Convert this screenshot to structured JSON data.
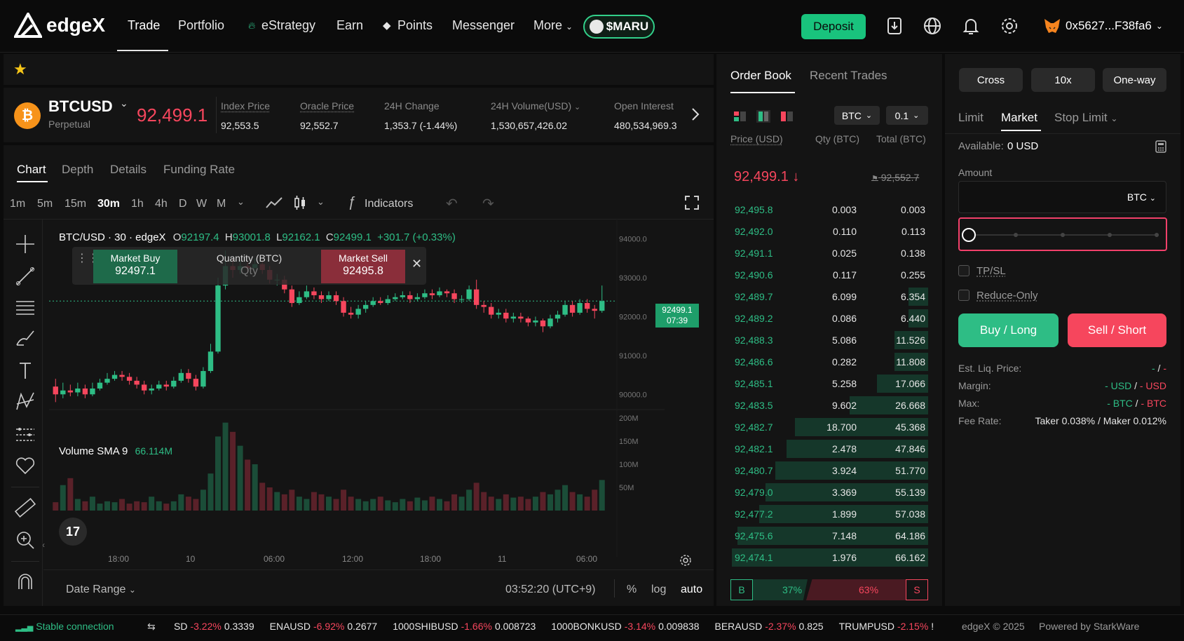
{
  "nav": {
    "logo": "edgeX",
    "items": [
      "Trade",
      "Portfolio",
      "eStrategy",
      "Earn",
      "Points",
      "Messenger",
      "More"
    ],
    "maru": "$MARU",
    "deposit": "Deposit",
    "wallet": "0x5627...F38fa6"
  },
  "ticker": {
    "symbol": "BTCUSD",
    "type": "Perpetual",
    "price": "92,499.1",
    "index_label": "Index Price",
    "index_val": "92,553.5",
    "oracle_label": "Oracle Price",
    "oracle_val": "92,552.7",
    "change_label": "24H Change",
    "change_val": "1,353.7 (-1.44%)",
    "volume_label": "24H Volume(USD)",
    "volume_val": "1,530,657,426.02",
    "oi_label": "Open Interest",
    "oi_val": "480,534,969.3"
  },
  "chart_tabs": [
    "Chart",
    "Depth",
    "Details",
    "Funding Rate"
  ],
  "timeframes": [
    "1m",
    "5m",
    "15m",
    "30m",
    "1h",
    "4h",
    "D",
    "W",
    "M"
  ],
  "indicators_label": "Indicators",
  "chart": {
    "pair": "BTC/USD · 30 · edgeX",
    "o_label": "O",
    "o": "92197.4",
    "h_label": "H",
    "h": "93001.8",
    "l_label": "L",
    "l": "92162.1",
    "c_label": "C",
    "c": "92499.1",
    "chg": "+301.7 (+0.33%)",
    "market_buy_label": "Market Buy",
    "market_buy": "92497.1",
    "qty_label": "Quantity (BTC)",
    "qty_placeholder": "Qty",
    "market_sell_label": "Market Sell",
    "market_sell": "92495.8",
    "last_tag_price": "92499.1",
    "last_tag_time": "07:39",
    "volume_label": "Volume SMA 9",
    "volume_val": "66.114M",
    "price_ticks": [
      "94000.0",
      "93000.0",
      "92000.0",
      "91000.0",
      "90000.0"
    ],
    "vol_ticks": [
      "200M",
      "150M",
      "100M",
      "50M"
    ],
    "time_ticks": [
      "18:00",
      "10",
      "06:00",
      "12:00",
      "18:00",
      "11",
      "06:00"
    ],
    "date_range": "Date Range",
    "clock": "03:52:20 (UTC+9)",
    "pct": "%",
    "log": "log",
    "auto": "auto"
  },
  "chart_data": {
    "type": "candlestick",
    "y_range": [
      89500,
      94300
    ],
    "candles": [
      [
        90200,
        90000,
        90400,
        89800
      ],
      [
        90000,
        90100,
        90300,
        89900
      ],
      [
        90100,
        90050,
        90250,
        89950
      ],
      [
        90050,
        90150,
        90300,
        89950
      ],
      [
        90150,
        90000,
        90250,
        89900
      ],
      [
        90000,
        90150,
        90300,
        89950
      ],
      [
        90150,
        90300,
        90400,
        90100
      ],
      [
        90300,
        90400,
        90550,
        90250
      ],
      [
        90400,
        90500,
        90600,
        90350
      ],
      [
        90500,
        90450,
        90600,
        90350
      ],
      [
        90450,
        90350,
        90550,
        90250
      ],
      [
        90350,
        90250,
        90450,
        90150
      ],
      [
        90250,
        90100,
        90350,
        90000
      ],
      [
        90100,
        90150,
        90250,
        90000
      ],
      [
        90150,
        90250,
        90350,
        90100
      ],
      [
        90250,
        90200,
        90350,
        90100
      ],
      [
        90200,
        90350,
        90450,
        90150
      ],
      [
        90350,
        90550,
        90650,
        90300
      ],
      [
        90550,
        90400,
        90650,
        90300
      ],
      [
        90400,
        90200,
        90500,
        90100
      ],
      [
        90200,
        90600,
        90700,
        90150
      ],
      [
        90600,
        91100,
        91300,
        90550
      ],
      [
        91100,
        92800,
        93000,
        91050
      ],
      [
        92800,
        93300,
        93700,
        92700
      ],
      [
        93300,
        93200,
        93500,
        93000
      ],
      [
        93200,
        93300,
        93450,
        93100
      ],
      [
        93300,
        93250,
        93400,
        93150
      ],
      [
        93250,
        93350,
        93500,
        93200
      ],
      [
        93350,
        93200,
        93450,
        93100
      ],
      [
        93200,
        92950,
        93300,
        92850
      ],
      [
        92950,
        92950,
        93100,
        92800
      ],
      [
        92950,
        92700,
        93050,
        92600
      ],
      [
        92700,
        92350,
        92800,
        92250
      ],
      [
        92350,
        92500,
        92650,
        92300
      ],
      [
        92500,
        92650,
        92800,
        92450
      ],
      [
        92650,
        92550,
        92750,
        92450
      ],
      [
        92550,
        92450,
        92650,
        92350
      ],
      [
        92450,
        92550,
        92650,
        92400
      ],
      [
        92550,
        92400,
        92650,
        92300
      ],
      [
        92400,
        92100,
        92500,
        92000
      ],
      [
        92100,
        92050,
        92250,
        91950
      ],
      [
        92050,
        92200,
        92300,
        91950
      ],
      [
        92200,
        92300,
        92400,
        92100
      ],
      [
        92300,
        92400,
        92500,
        92250
      ],
      [
        92400,
        92350,
        92500,
        92300
      ],
      [
        92350,
        92450,
        92550,
        92300
      ],
      [
        92450,
        92500,
        92600,
        92400
      ],
      [
        92500,
        92550,
        92650,
        92450
      ],
      [
        92550,
        92450,
        92650,
        92350
      ],
      [
        92450,
        92500,
        92600,
        92400
      ],
      [
        92500,
        92600,
        92700,
        92450
      ],
      [
        92600,
        92550,
        92700,
        92450
      ],
      [
        92550,
        92650,
        92750,
        92500
      ],
      [
        92650,
        92600,
        92700,
        92500
      ],
      [
        92600,
        92450,
        92700,
        92350
      ],
      [
        92450,
        92450,
        92550,
        92350
      ],
      [
        92450,
        92700,
        92800,
        92400
      ],
      [
        92700,
        92300,
        92950,
        92200
      ],
      [
        92300,
        92250,
        92400,
        92100
      ],
      [
        92250,
        92050,
        92350,
        91950
      ],
      [
        92050,
        92100,
        92200,
        91950
      ],
      [
        92100,
        91950,
        92200,
        91850
      ],
      [
        91950,
        92000,
        92100,
        91850
      ],
      [
        92000,
        91950,
        92100,
        91850
      ],
      [
        91950,
        91850,
        92000,
        91750
      ],
      [
        91850,
        91900,
        92000,
        91750
      ],
      [
        91900,
        91750,
        91950,
        91600
      ],
      [
        91750,
        91950,
        92050,
        91700
      ],
      [
        91950,
        92050,
        92150,
        91850
      ],
      [
        92050,
        92300,
        92400,
        92000
      ],
      [
        92300,
        92100,
        92400,
        92000
      ],
      [
        92100,
        92350,
        92450,
        92050
      ],
      [
        92350,
        92200,
        92450,
        92100
      ],
      [
        92200,
        92150,
        92300,
        91950
      ],
      [
        92150,
        92400,
        92800,
        92100
      ]
    ],
    "volumes": [
      18,
      55,
      70,
      25,
      20,
      30,
      15,
      20,
      18,
      25,
      15,
      20,
      18,
      30,
      20,
      15,
      20,
      35,
      30,
      25,
      45,
      80,
      160,
      190,
      170,
      140,
      110,
      100,
      60,
      50,
      40,
      35,
      45,
      30,
      25,
      40,
      35,
      30,
      25,
      45,
      30,
      25,
      20,
      25,
      30,
      22,
      18,
      25,
      20,
      28,
      22,
      30,
      25,
      20,
      35,
      30,
      45,
      60,
      40,
      30,
      25,
      35,
      28,
      30,
      25,
      30,
      40,
      35,
      45,
      55,
      40,
      35,
      30,
      45,
      66
    ]
  },
  "orderbook": {
    "tabs": [
      "Order Book",
      "Recent Trades"
    ],
    "asset": "BTC",
    "step": "0.1",
    "headers": [
      "Price (USD)",
      "Qty (BTC)",
      "Total (BTC)"
    ],
    "last_price": "92,499.1",
    "mark_price": "92,552.7",
    "rows": [
      {
        "p": "92,495.8",
        "q": "0.003",
        "t": "0.003",
        "d": 0.0
      },
      {
        "p": "92,492.0",
        "q": "0.110",
        "t": "0.113",
        "d": 0.0
      },
      {
        "p": "92,491.1",
        "q": "0.025",
        "t": "0.138",
        "d": 0.0
      },
      {
        "p": "92,490.6",
        "q": "0.117",
        "t": "0.255",
        "d": 0.0
      },
      {
        "p": "92,489.7",
        "q": "6.099",
        "t": "6.354",
        "d": 0.1
      },
      {
        "p": "92,489.2",
        "q": "0.086",
        "t": "6.440",
        "d": 0.1
      },
      {
        "p": "92,488.3",
        "q": "5.086",
        "t": "11.526",
        "d": 0.17
      },
      {
        "p": "92,486.6",
        "q": "0.282",
        "t": "11.808",
        "d": 0.17
      },
      {
        "p": "92,485.1",
        "q": "5.258",
        "t": "17.066",
        "d": 0.26
      },
      {
        "p": "92,483.5",
        "q": "9.602",
        "t": "26.668",
        "d": 0.4
      },
      {
        "p": "92,482.7",
        "q": "18.700",
        "t": "45.368",
        "d": 0.68
      },
      {
        "p": "92,482.1",
        "q": "2.478",
        "t": "47.846",
        "d": 0.72
      },
      {
        "p": "92,480.7",
        "q": "3.924",
        "t": "51.770",
        "d": 0.78
      },
      {
        "p": "92,479.0",
        "q": "3.369",
        "t": "55.139",
        "d": 0.83
      },
      {
        "p": "92,477.2",
        "q": "1.899",
        "t": "57.038",
        "d": 0.86
      },
      {
        "p": "92,475.6",
        "q": "7.148",
        "t": "64.186",
        "d": 0.97
      },
      {
        "p": "92,474.1",
        "q": "1.976",
        "t": "66.162",
        "d": 1.0
      }
    ],
    "buy_pct": "37%",
    "sell_pct": "63%",
    "b": "B",
    "s": "S"
  },
  "trade": {
    "margin_mode": "Cross",
    "leverage": "10x",
    "position_mode": "One-way",
    "order_types": [
      "Limit",
      "Market",
      "Stop Limit"
    ],
    "available_label": "Available:",
    "available_val": "0 USD",
    "amount_label": "Amount",
    "amount_unit": "BTC",
    "tpsl": "TP/SL",
    "reduce_only": "Reduce-Only",
    "buy": "Buy / Long",
    "sell": "Sell / Short",
    "liq_label": "Est. Liq. Price:",
    "liq_a": "-",
    "liq_sep": "/",
    "liq_b": "-",
    "margin_label": "Margin:",
    "margin_a": "- USD",
    "margin_sep": "/",
    "margin_b": "- USD",
    "max_label": "Max:",
    "max_a": "- BTC",
    "max_sep": "/",
    "max_b": "- BTC",
    "fee_label": "Fee Rate:",
    "fee_val": "Taker 0.038% / Maker 0.012%"
  },
  "bottom": {
    "connection": "Stable connection",
    "tickers": [
      {
        "sym": "SD",
        "chg": "-3.22%",
        "px": "0.3339"
      },
      {
        "sym": "ENAUSD",
        "chg": "-6.92%",
        "px": "0.2677"
      },
      {
        "sym": "1000SHIBUSD",
        "chg": "-1.66%",
        "px": "0.008723"
      },
      {
        "sym": "1000BONKUSD",
        "chg": "-3.14%",
        "px": "0.009838"
      },
      {
        "sym": "BERAUSD",
        "chg": "-2.37%",
        "px": "0.825"
      },
      {
        "sym": "TRUMPUSD",
        "chg": "-2.15%",
        "px": "!"
      }
    ],
    "copyright": "edgeX © 2025",
    "powered": "Powered by StarkWare"
  },
  "colors": {
    "green": "#2ebd85",
    "red": "#f6465d",
    "accent": "#19c37d"
  }
}
